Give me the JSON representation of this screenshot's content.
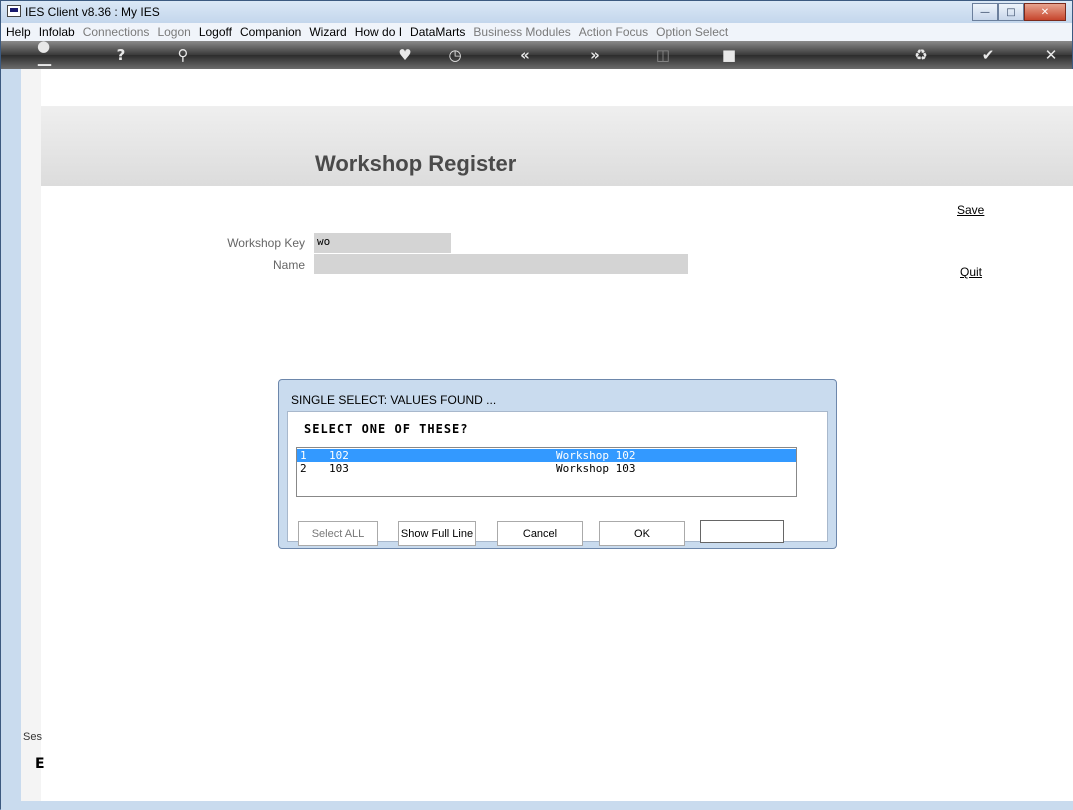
{
  "window": {
    "title": "IES Client v8.36 : My IES"
  },
  "menu": {
    "items": [
      {
        "label": "Help",
        "enabled": true
      },
      {
        "label": "Infolab",
        "enabled": true
      },
      {
        "label": "Connections",
        "enabled": false
      },
      {
        "label": "Logon",
        "enabled": false
      },
      {
        "label": "Logoff",
        "enabled": true
      },
      {
        "label": "Companion",
        "enabled": true
      },
      {
        "label": "Wizard",
        "enabled": true
      },
      {
        "label": "How do I",
        "enabled": true
      },
      {
        "label": "DataMarts",
        "enabled": true
      },
      {
        "label": "Business Modules",
        "enabled": false
      },
      {
        "label": "Action Focus",
        "enabled": false
      },
      {
        "label": "Option Select",
        "enabled": false
      }
    ]
  },
  "toolbar": {
    "icons": [
      "key-icon",
      "help-icon",
      "search-icon",
      "heart-icon",
      "clock-icon",
      "rewind-icon",
      "forward-icon",
      "trash-icon",
      "stop-icon",
      "recycle-icon",
      "check-icon",
      "close-icon"
    ]
  },
  "form": {
    "title": "Workshop Register",
    "save_label": "Save",
    "quit_label": "Quit",
    "key_label": "Workshop Key",
    "key_value": "wo",
    "name_label": "Name",
    "name_value": ""
  },
  "sidebar": {
    "label": "Ses",
    "glyph": "E"
  },
  "dialog": {
    "title": "SINGLE SELECT: VALUES FOUND ...",
    "prompt": "SELECT ONE OF THESE?",
    "rows": [
      {
        "num": "1",
        "code": "102",
        "desc": "Workshop 102",
        "selected": true
      },
      {
        "num": "2",
        "code": "103",
        "desc": "Workshop 103",
        "selected": false
      }
    ],
    "buttons": {
      "select_all": "Select ALL",
      "show_full_line": "Show Full Line",
      "cancel": "Cancel",
      "ok": "OK"
    }
  },
  "colors": {
    "selection": "#3399ff",
    "window_frame": "#c9dbee",
    "toolbar": "#3a3a3a"
  }
}
